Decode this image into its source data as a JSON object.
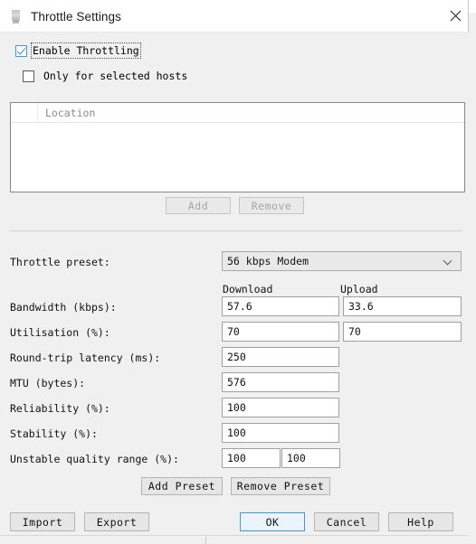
{
  "window": {
    "title": "Throttle Settings",
    "icon": "app-icon",
    "close_icon": "close-icon"
  },
  "options": {
    "enable_throttling": {
      "label": "Enable Throttling",
      "checked": true,
      "focused": true
    },
    "only_selected_hosts": {
      "label": "Only for selected hosts",
      "checked": false
    }
  },
  "host_list": {
    "columns": [
      "",
      "Location"
    ],
    "rows": [],
    "add_button": "Add",
    "remove_button": "Remove",
    "add_enabled": false,
    "remove_enabled": false
  },
  "throttle": {
    "preset_label": "Throttle preset:",
    "preset_value": "56 kbps Modem",
    "column_headers": {
      "download": "Download",
      "upload": "Upload"
    },
    "rows": [
      {
        "label": "Bandwidth (kbps):",
        "download": "57.6",
        "upload": "33.6"
      },
      {
        "label": "Utilisation (%):",
        "download": "70",
        "upload": "70"
      },
      {
        "label": "Round-trip latency (ms):",
        "download": "250",
        "upload": null
      },
      {
        "label": "MTU (bytes):",
        "download": "576",
        "upload": null
      },
      {
        "label": "Reliability (%):",
        "download": "100",
        "upload": null
      },
      {
        "label": "Stability (%):",
        "download": "100",
        "upload": null
      },
      {
        "label": "Unstable quality range (%):",
        "download": "100",
        "upload": "100"
      }
    ],
    "add_preset_button": "Add Preset",
    "remove_preset_button": "Remove Preset"
  },
  "footer": {
    "import_button": "Import",
    "export_button": "Export",
    "ok_button": "OK",
    "cancel_button": "Cancel",
    "help_button": "Help"
  },
  "colors": {
    "accent": "#3c9adc",
    "dialog_bg": "#f0f0f0",
    "field_bg": "#ffffff",
    "button_bg": "#e6e6e6",
    "default_button_bg": "#eaf4fc"
  }
}
